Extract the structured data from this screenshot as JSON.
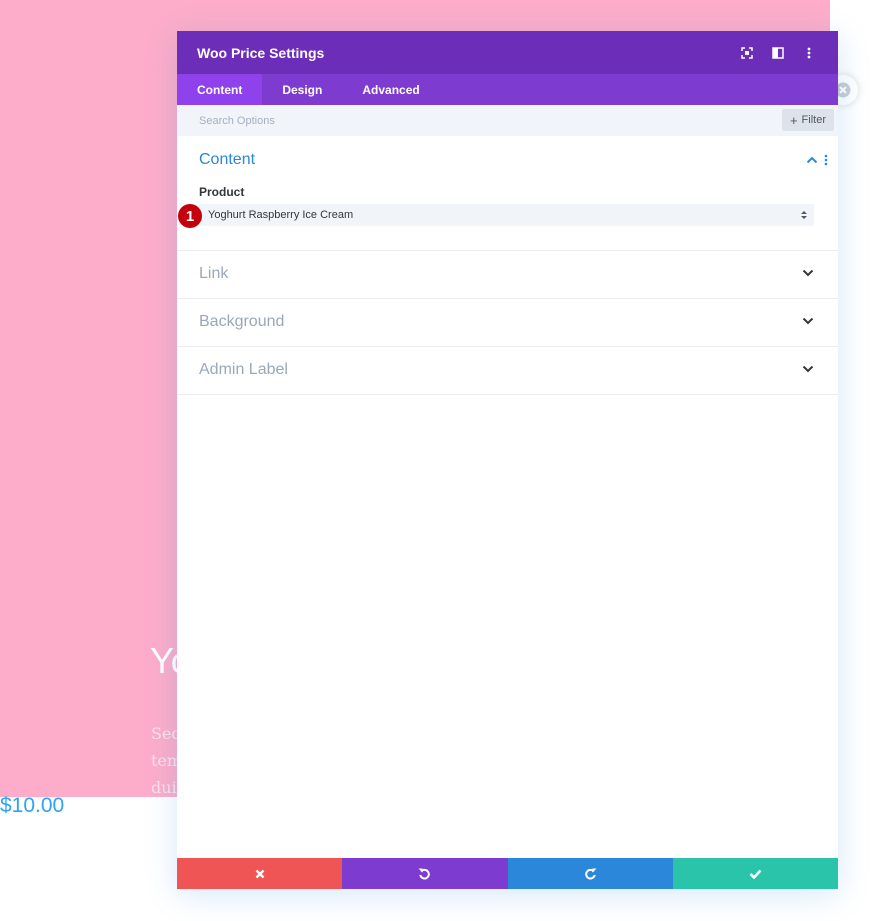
{
  "page": {
    "heading": "Yo",
    "body_lines": [
      "Sed",
      "tem",
      "dui."
    ],
    "price": "$10.00"
  },
  "modal": {
    "title": "Woo Price Settings",
    "tabs": [
      {
        "label": "Content",
        "active": true
      },
      {
        "label": "Design",
        "active": false
      },
      {
        "label": "Advanced",
        "active": false
      }
    ],
    "search_placeholder": "Search Options",
    "filter_label": "Filter",
    "sections": {
      "content": {
        "title": "Content",
        "field_label": "Product",
        "product_value": "Yoghurt Raspberry Ice Cream"
      },
      "link": {
        "title": "Link"
      },
      "background": {
        "title": "Background"
      },
      "admin_label": {
        "title": "Admin Label"
      }
    },
    "step_badge": "1"
  },
  "colors": {
    "header": "#6c2eb9",
    "tabs": "#7e3bd0",
    "active_tab": "#8f42ec",
    "accent": "#2b87da",
    "cancel": "#ef5555",
    "save": "#29c4a9",
    "page_bg": "#fdadc9"
  },
  "icons": {
    "header": [
      "fullscreen-icon",
      "split-view-icon",
      "more-vertical-icon"
    ],
    "footer": [
      "close-icon",
      "undo-icon",
      "redo-icon",
      "check-icon"
    ]
  }
}
